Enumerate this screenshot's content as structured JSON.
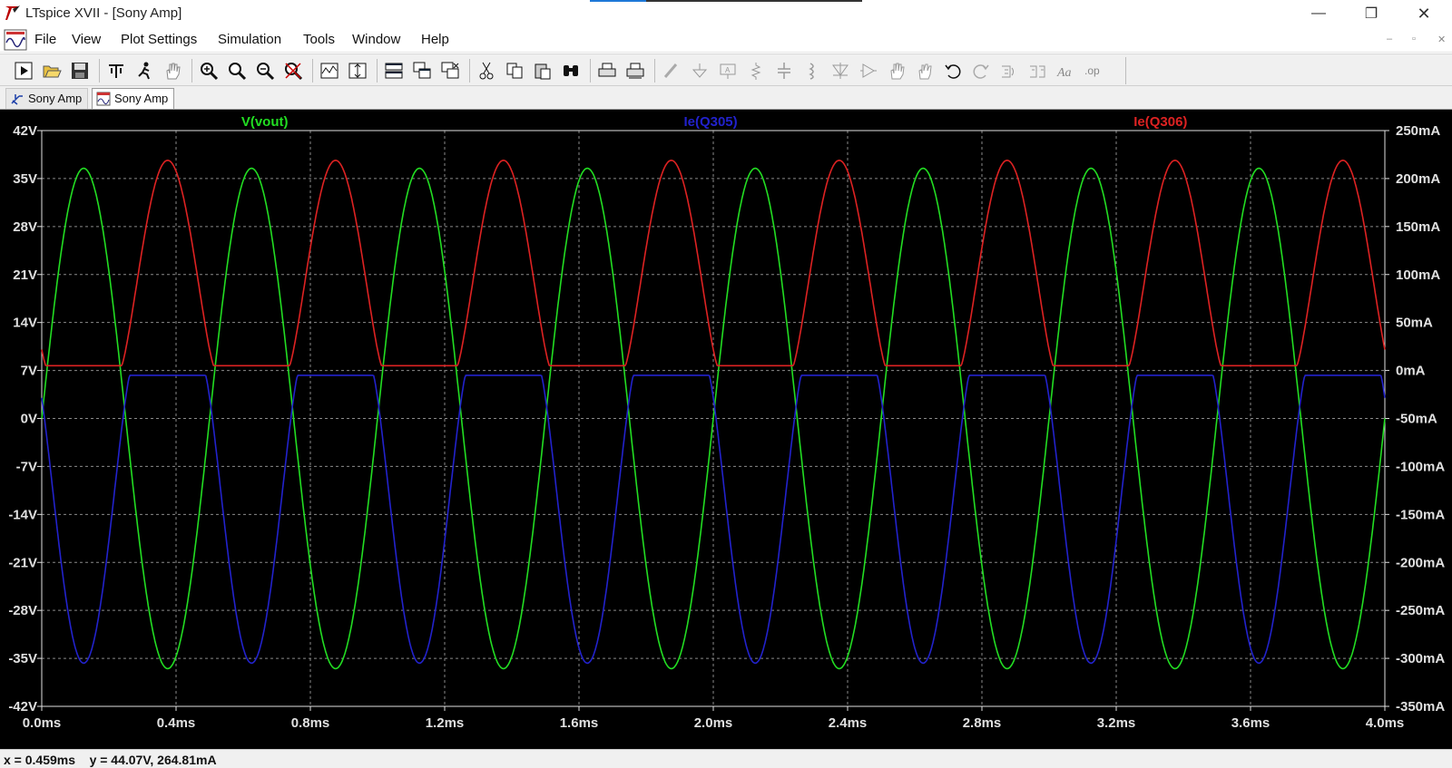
{
  "window": {
    "title": "LTspice XVII - [Sony Amp]",
    "minimize_glyph": "—",
    "maximize_glyph": "❐",
    "close_glyph": "✕"
  },
  "menu": {
    "items": [
      "File",
      "View",
      "Plot Settings",
      "Simulation",
      "Tools",
      "Window",
      "Help"
    ],
    "mdi_buttons": [
      "–",
      "▫",
      "✕"
    ]
  },
  "toolbar": {
    "icons": [
      "run-icon",
      "open-icon",
      "save-icon",
      "control-panel-icon",
      "halt-icon",
      "pan-icon",
      "zoom-in-icon",
      "zoom-area-icon",
      "zoom-out-icon",
      "zoom-cancel-icon",
      "autorange-icon",
      "autorange-y-icon",
      "tile-horizontal-icon",
      "cascade-icon",
      "close-all-icon",
      "cut-icon",
      "copy-icon",
      "paste-icon",
      "find-icon",
      "print-icon",
      "print-preview-icon",
      "wire-icon",
      "ground-icon",
      "label-icon",
      "resistor-icon",
      "capacitor-icon",
      "inductor-icon",
      "diode-icon",
      "component-icon",
      "move-icon",
      "drag-icon",
      "undo-icon",
      "redo-icon",
      "rotate-icon",
      "mirror-icon",
      "text-icon",
      "spice-directive-icon"
    ]
  },
  "tabs": [
    {
      "label": "Sony Amp",
      "icon": "schematic-icon",
      "active": false
    },
    {
      "label": "Sony Amp",
      "icon": "waveform-icon",
      "active": true
    }
  ],
  "status": {
    "cursor_readout": "x = 0.459ms    y = 44.07V, 264.81mA"
  },
  "colors": {
    "plot_bg": "#000000",
    "grid": "#8a8a8a",
    "axis_text": "#e0e0e0",
    "vout": "#22dd22",
    "ie_q305": "#2222cc",
    "ie_q306": "#dd2222"
  },
  "chart_data": {
    "type": "line",
    "title": "",
    "xlabel": "",
    "ylabel": "",
    "x_ticks": [
      "0.0ms",
      "0.4ms",
      "0.8ms",
      "1.2ms",
      "1.6ms",
      "2.0ms",
      "2.4ms",
      "2.8ms",
      "3.2ms",
      "3.6ms",
      "4.0ms"
    ],
    "y_left_ticks": [
      "42V",
      "35V",
      "28V",
      "21V",
      "14V",
      "7V",
      "0V",
      "-7V",
      "-14V",
      "-21V",
      "-28V",
      "-35V",
      "-42V"
    ],
    "y_right_ticks": [
      "250mA",
      "200mA",
      "150mA",
      "100mA",
      "50mA",
      "0mA",
      "-50mA",
      "-100mA",
      "-150mA",
      "-200mA",
      "-250mA",
      "-300mA",
      "-350mA"
    ],
    "xlim": [
      0,
      4.0
    ],
    "ylim_left": [
      -42,
      42
    ],
    "ylim_right": [
      -350,
      250
    ],
    "grid": true,
    "series": [
      {
        "name": "V(vout)",
        "axis": "left",
        "unit": "V",
        "shape": "sine",
        "frequency_khz": 2,
        "amplitude": 36.5,
        "offset": 0,
        "phase": 0
      },
      {
        "name": "Ie(Q305)",
        "axis": "right",
        "unit": "mA",
        "shape": "clipped-sine",
        "frequency_khz": 2,
        "peak": -305,
        "baseline": -5,
        "offset": 0
      },
      {
        "name": "Ie(Q306)",
        "axis": "right",
        "unit": "mA",
        "shape": "clipped-sine",
        "frequency_khz": 2,
        "peak": 219,
        "baseline": 5,
        "offset": 0.5
      }
    ]
  }
}
